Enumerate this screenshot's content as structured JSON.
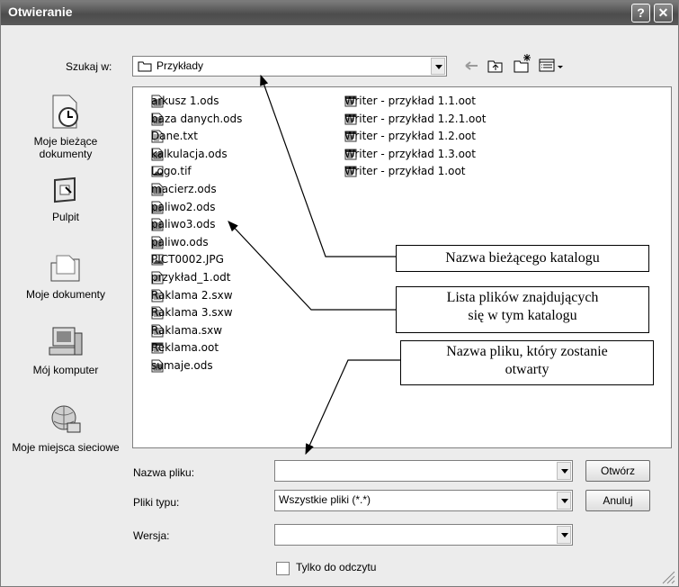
{
  "window": {
    "title": "Otwieranie",
    "help_label": "?",
    "close_label": "✕"
  },
  "lookin": {
    "label": "Szukaj w:",
    "value": "Przykłady"
  },
  "places": [
    {
      "label": "Moje bieżące dokumenty",
      "icon": "recent-documents-icon"
    },
    {
      "label": "Pulpit",
      "icon": "desktop-icon"
    },
    {
      "label": "Moje dokumenty",
      "icon": "my-documents-icon"
    },
    {
      "label": "Mój komputer",
      "icon": "my-computer-icon"
    },
    {
      "label": "Moje miejsca sieciowe",
      "icon": "network-places-icon"
    }
  ],
  "files_left": [
    {
      "name": "arkusz 1.ods",
      "icon": "spreadsheet-icon"
    },
    {
      "name": "baza danych.ods",
      "icon": "spreadsheet-icon"
    },
    {
      "name": "Dane.txt",
      "icon": "text-file-icon"
    },
    {
      "name": "kalkulacja.ods",
      "icon": "spreadsheet-icon"
    },
    {
      "name": "Logo.tif",
      "icon": "image-file-icon"
    },
    {
      "name": "macierz.ods",
      "icon": "spreadsheet-icon"
    },
    {
      "name": "paliwo2.ods",
      "icon": "spreadsheet-icon"
    },
    {
      "name": "paliwo3.ods",
      "icon": "spreadsheet-icon"
    },
    {
      "name": "paliwo.ods",
      "icon": "spreadsheet-icon"
    },
    {
      "name": "PICT0002.JPG",
      "icon": "image-file-icon"
    },
    {
      "name": "przykład_1.odt",
      "icon": "document-file-icon"
    },
    {
      "name": "Raklama 2.sxw",
      "icon": "document-file-icon"
    },
    {
      "name": "Raklama 3.sxw",
      "icon": "document-file-icon"
    },
    {
      "name": "Raklama.sxw",
      "icon": "document-file-icon"
    },
    {
      "name": "Reklama.oot",
      "icon": "template-file-icon"
    },
    {
      "name": "sumaje.ods",
      "icon": "spreadsheet-icon"
    }
  ],
  "files_right": [
    {
      "name": "Writer - przykład 1.1.oot",
      "icon": "template-file-icon"
    },
    {
      "name": "Writer - przykład 1.2.1.oot",
      "icon": "template-file-icon"
    },
    {
      "name": "Writer - przykład 1.2.oot",
      "icon": "template-file-icon"
    },
    {
      "name": "Writer - przykład 1.3.oot",
      "icon": "template-file-icon"
    },
    {
      "name": "Writer - przykład 1.oot",
      "icon": "template-file-icon"
    }
  ],
  "form": {
    "filename_label": "Nazwa pliku:",
    "filename_value": "",
    "filetype_label": "Pliki typu:",
    "filetype_value": "Wszystkie pliki (*.*)",
    "version_label": "Wersja:",
    "version_value": "",
    "readonly_label": "Tylko do odczytu",
    "open_label": "Otwórz",
    "cancel_label": "Anuluj"
  },
  "annotations": {
    "current_folder": "Nazwa bieżącego katalogu",
    "file_list_line1": "Lista plików znajdujących",
    "file_list_line2": "się w tym katalogu",
    "file_name_line1": "Nazwa pliku, który zostanie",
    "file_name_line2": "otwarty"
  }
}
